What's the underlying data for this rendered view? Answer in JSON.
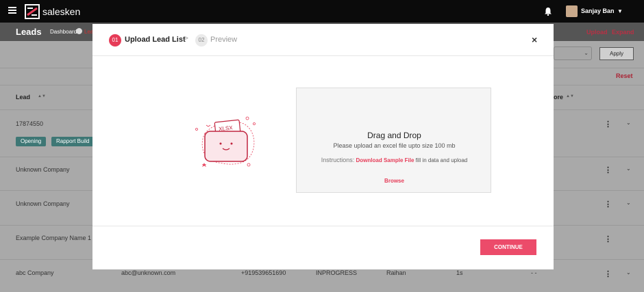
{
  "app": {
    "name": "salesken"
  },
  "user": {
    "name": "Sanjay Ban"
  },
  "header": {
    "title": "Leads",
    "breadcrumb_home": "Dashboard",
    "breadcrumb_current": "Lea",
    "upload_label": "Upload",
    "expand_label": "Expand"
  },
  "filters": {
    "apply_label": "Apply",
    "reset_label": "Reset"
  },
  "table": {
    "columns": [
      "Lead",
      "ore"
    ],
    "rows": [
      {
        "lead": "17874550",
        "tags": [
          "Opening",
          "Rapport Build"
        ]
      },
      {
        "lead": "Unknown Company"
      },
      {
        "lead": "Unknown Company"
      },
      {
        "lead": "Example Company Name 1"
      },
      {
        "lead": "abc Company",
        "email": "abc@unknown.com",
        "phone": "+919539651690",
        "status": "INPROGRESS",
        "owner": "Raihan",
        "duration": "1s",
        "extra": "- -"
      }
    ]
  },
  "modal": {
    "steps": [
      {
        "num": "01",
        "label": "Upload Lead List"
      },
      {
        "num": "02",
        "label": "Preview"
      }
    ],
    "step_arrow": ">",
    "close": "×",
    "illustration_text": "XLSX",
    "dropzone": {
      "title": "Drag and Drop",
      "subtitle": "Please upload an excel file upto size 100 mb",
      "instructions_label": "Instructions:",
      "sample_link": "Download Sample File",
      "instructions_rest": "fill in data and upload",
      "browse": "Browse"
    },
    "continue_label": "CONTINUE"
  },
  "colors": {
    "accent": "#e63c58",
    "tag": "#3e7775",
    "topbar": "#0b0b0b"
  }
}
